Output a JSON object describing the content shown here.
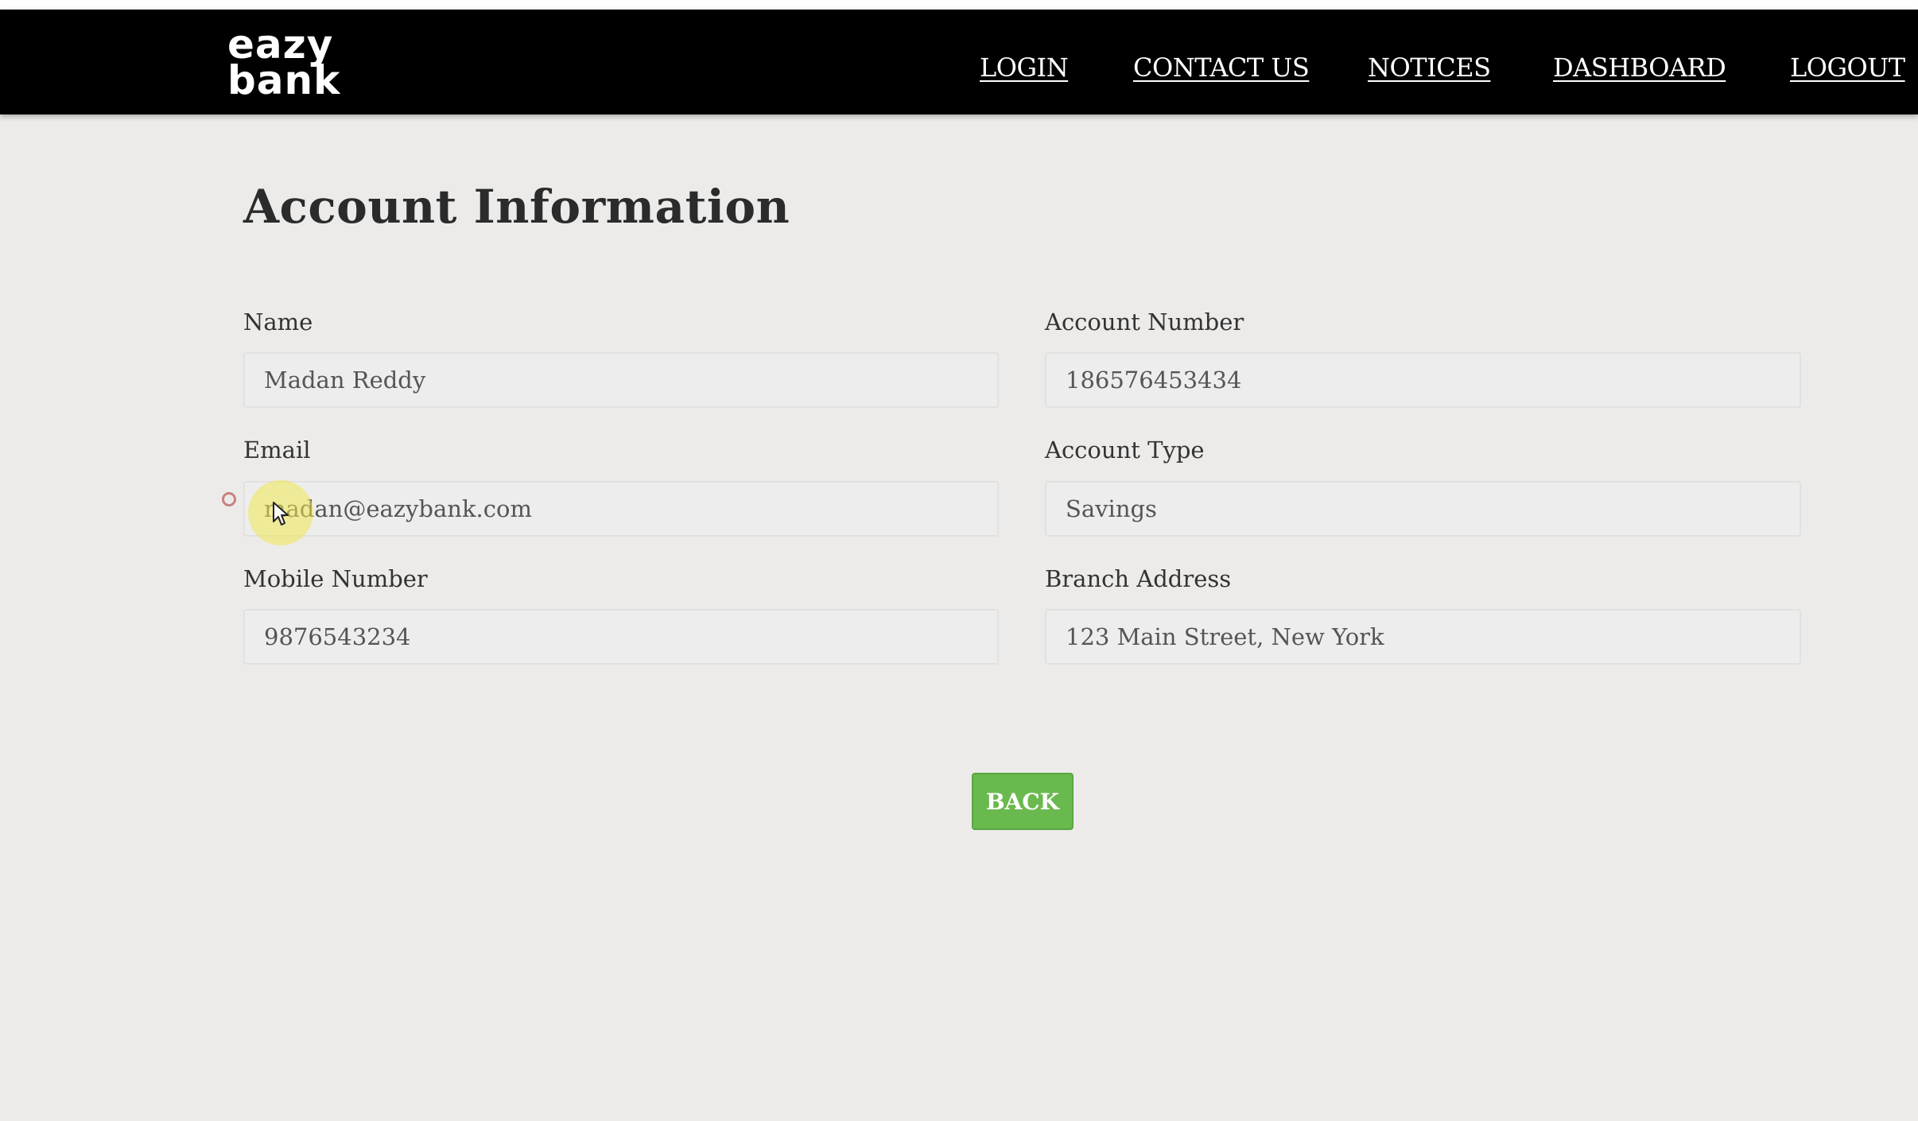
{
  "brand": {
    "line1": "eazy",
    "line2": "bank"
  },
  "nav": {
    "login": "LOGIN",
    "contact_us": "CONTACT US",
    "notices": "NOTICES",
    "dashboard": "DASHBOARD",
    "logout": "LOGOUT"
  },
  "page": {
    "title": "Account Information"
  },
  "fields": {
    "name": {
      "label": "Name",
      "value": "Madan Reddy"
    },
    "email": {
      "label": "Email",
      "value": "madan@eazybank.com"
    },
    "mobile": {
      "label": "Mobile Number",
      "value": "9876543234"
    },
    "account_number": {
      "label": "Account Number",
      "value": "186576453434"
    },
    "account_type": {
      "label": "Account Type",
      "value": "Savings"
    },
    "branch_address": {
      "label": "Branch Address",
      "value": "123 Main Street, New York"
    }
  },
  "actions": {
    "back_label": "BACK"
  },
  "colors": {
    "navbar_bg": "#000000",
    "page_bg": "#ecebe9",
    "back_button": "#6ab94f"
  }
}
